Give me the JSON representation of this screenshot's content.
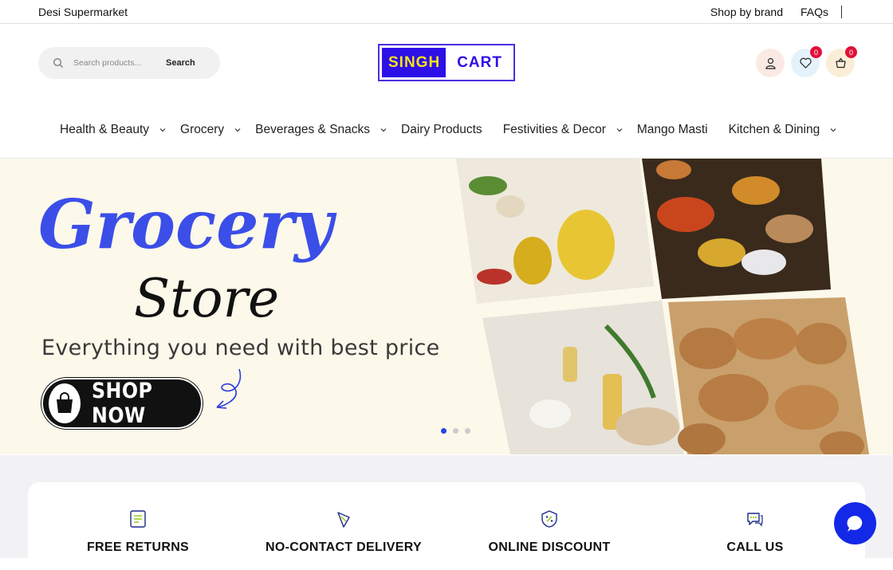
{
  "topbar": {
    "store_name": "Desi Supermarket",
    "links": [
      "Shop by brand",
      "FAQs"
    ]
  },
  "search": {
    "placeholder": "Search products...",
    "button": "Search"
  },
  "logo": {
    "left": "SINGH",
    "right": "CART"
  },
  "header_icons": {
    "account": "user-icon",
    "wishlist_count": "0",
    "cart_count": "0"
  },
  "nav": [
    {
      "label": "Health & Beauty",
      "dropdown": true
    },
    {
      "label": "Grocery",
      "dropdown": true
    },
    {
      "label": "Beverages & Snacks",
      "dropdown": true
    },
    {
      "label": "Dairy Products",
      "dropdown": false
    },
    {
      "label": "Festivities & Decor",
      "dropdown": true
    },
    {
      "label": "Mango Masti",
      "dropdown": false
    },
    {
      "label": "Kitchen & Dining",
      "dropdown": true
    }
  ],
  "hero": {
    "script_title": "Grocery",
    "script_sub": "Store",
    "tagline": "Everything you need with best price",
    "cta": "SHOP NOW",
    "slide_active": 1,
    "slide_count": 3
  },
  "features": [
    {
      "icon": "returns-icon",
      "title": "FREE RETURNS"
    },
    {
      "icon": "delivery-icon",
      "title": "NO-CONTACT DELIVERY"
    },
    {
      "icon": "discount-icon",
      "title": "ONLINE DISCOUNT"
    },
    {
      "icon": "chat-bubbles-icon",
      "title": "CALL US"
    }
  ],
  "colors": {
    "brand_blue": "#2d0fe8",
    "brand_yellow": "#f7e21a",
    "badge_red": "#e0103a",
    "hero_bg": "#fcf8ea",
    "script_blue": "#3b4ee8"
  }
}
